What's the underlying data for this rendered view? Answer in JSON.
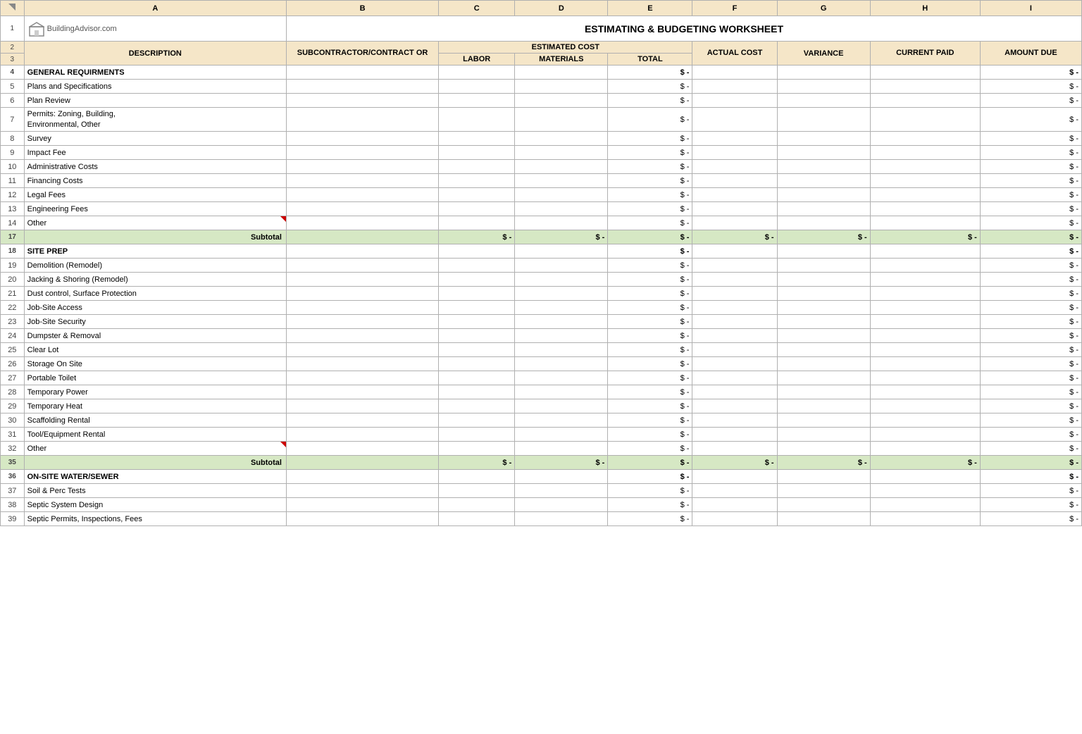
{
  "app": {
    "logo_text": "BuildingAdvisor.com",
    "title": "ESTIMATING & BUDGETING WORKSHEET"
  },
  "columns": {
    "row_header": "#",
    "a_header": "A",
    "b_header": "B",
    "c_header": "C",
    "d_header": "D",
    "e_header": "E",
    "f_header": "F",
    "g_header": "G",
    "h_header": "H",
    "i_header": "I"
  },
  "headers": {
    "description": "DESCRIPTION",
    "subcontractor": "SUBCONTRACTOR/CONTRACT OR",
    "estimated_cost": "ESTIMATED COST",
    "labor": "LABOR",
    "materials": "MATERIALS",
    "total": "TOTAL",
    "actual_cost": "ACTUAL COST",
    "variance": "VARIANCE",
    "current_paid": "CURRENT PAID",
    "amount_due": "AMOUNT DUE"
  },
  "rows": [
    {
      "num": "4",
      "label": "GENERAL REQUIRMENTS",
      "section": true,
      "total": "$ -",
      "amount_due": "$ -"
    },
    {
      "num": "5",
      "label": "Plans and Specifications",
      "total": "$ -",
      "amount_due": "$ -"
    },
    {
      "num": "6",
      "label": "Plan Review",
      "total": "$ -",
      "amount_due": "$ -"
    },
    {
      "num": "7",
      "label": "Permits: Zoning, Building,\nEnvironmental, Other",
      "multiline": true,
      "total": "$ -",
      "amount_due": "$ -"
    },
    {
      "num": "8",
      "label": "Survey",
      "total": "$ -",
      "amount_due": "$ -"
    },
    {
      "num": "9",
      "label": "Impact Fee",
      "total": "$ -",
      "amount_due": "$ -"
    },
    {
      "num": "10",
      "label": "Administrative Costs",
      "total": "$ -",
      "amount_due": "$ -"
    },
    {
      "num": "11",
      "label": "Financing Costs",
      "total": "$ -",
      "amount_due": "$ -"
    },
    {
      "num": "12",
      "label": "Legal Fees",
      "total": "$ -",
      "amount_due": "$ -"
    },
    {
      "num": "13",
      "label": "Engineering Fees",
      "total": "$ -",
      "amount_due": "$ -"
    },
    {
      "num": "14",
      "label": "Other",
      "red_corner": true,
      "total": "$ -",
      "amount_due": "$ -"
    },
    {
      "num": "17",
      "label": "Subtotal",
      "subtotal": true,
      "labor": "$ -",
      "materials": "$ -",
      "total": "$ -",
      "actual": "$ -",
      "variance": "$ -",
      "current_paid": "$ -",
      "amount_due": "$ -"
    },
    {
      "num": "18",
      "label": "SITE PREP",
      "section": true,
      "total": "$ -",
      "amount_due": "$ -"
    },
    {
      "num": "19",
      "label": "Demolition (Remodel)",
      "total": "$ -",
      "amount_due": "$ -"
    },
    {
      "num": "20",
      "label": "Jacking & Shoring (Remodel)",
      "total": "$ -",
      "amount_due": "$ -"
    },
    {
      "num": "21",
      "label": "Dust control, Surface Protection",
      "total": "$ -",
      "amount_due": "$ -"
    },
    {
      "num": "22",
      "label": "Job-Site Access",
      "total": "$ -",
      "amount_due": "$ -"
    },
    {
      "num": "23",
      "label": "Job-Site Security",
      "total": "$ -",
      "amount_due": "$ -"
    },
    {
      "num": "24",
      "label": "Dumpster & Removal",
      "total": "$ -",
      "amount_due": "$ -"
    },
    {
      "num": "25",
      "label": "Clear Lot",
      "total": "$ -",
      "amount_due": "$ -"
    },
    {
      "num": "26",
      "label": "Storage On Site",
      "total": "$ -",
      "amount_due": "$ -"
    },
    {
      "num": "27",
      "label": "Portable Toilet",
      "total": "$ -",
      "amount_due": "$ -"
    },
    {
      "num": "28",
      "label": "Temporary Power",
      "total": "$ -",
      "amount_due": "$ -"
    },
    {
      "num": "29",
      "label": "Temporary Heat",
      "total": "$ -",
      "amount_due": "$ -"
    },
    {
      "num": "30",
      "label": "Scaffolding Rental",
      "total": "$ -",
      "amount_due": "$ -"
    },
    {
      "num": "31",
      "label": "Tool/Equipment Rental",
      "total": "$ -",
      "amount_due": "$ -"
    },
    {
      "num": "32",
      "label": "Other",
      "red_corner": true,
      "total": "$ -",
      "amount_due": "$ -"
    },
    {
      "num": "35",
      "label": "Subtotal",
      "subtotal": true,
      "labor": "$ -",
      "materials": "$ -",
      "total": "$ -",
      "actual": "$ -",
      "variance": "$ -",
      "current_paid": "$ -",
      "amount_due": "$ -"
    },
    {
      "num": "36",
      "label": "ON-SITE WATER/SEWER",
      "section": true,
      "total": "$ -",
      "amount_due": "$ -"
    },
    {
      "num": "37",
      "label": "Soil & Perc Tests",
      "total": "$ -",
      "amount_due": "$ -"
    },
    {
      "num": "38",
      "label": "Septic System Design",
      "total": "$ -",
      "amount_due": "$ -"
    },
    {
      "num": "39",
      "label": "Septic Permits, Inspections, Fees",
      "total": "$ -",
      "amount_due": "$ -"
    }
  ]
}
